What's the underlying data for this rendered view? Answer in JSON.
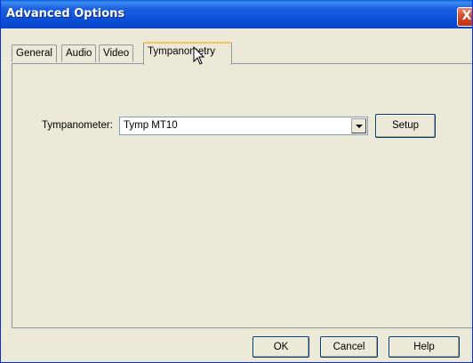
{
  "window": {
    "title": "Advanced Options",
    "close_glyph": "X"
  },
  "tabs": [
    {
      "label": "General",
      "active": false
    },
    {
      "label": "Audio",
      "active": false
    },
    {
      "label": "Video",
      "active": false
    },
    {
      "label": "Tympanometry",
      "active": true
    }
  ],
  "tympanometry": {
    "field_label": "Tympanometer:",
    "selected_value": "Tymp MT10",
    "setup_label": "Setup"
  },
  "footer": {
    "ok_label": "OK",
    "cancel_label": "Cancel",
    "help_label": "Help"
  },
  "icons": {
    "close": "close-icon",
    "dropdown": "chevron-down-icon",
    "cursor": "mouse-pointer-icon"
  },
  "colors": {
    "titlebar": "#0a4fd6",
    "dialog_bg": "#ece9d8",
    "close_button": "#d5482a"
  }
}
